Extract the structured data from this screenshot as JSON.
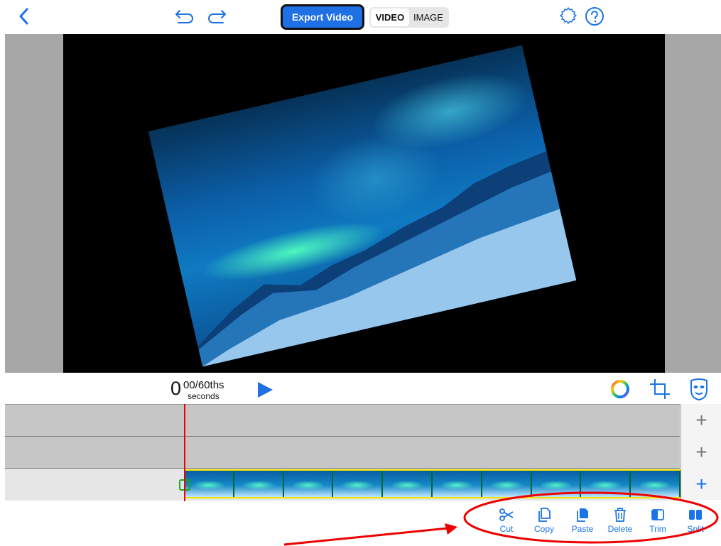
{
  "header": {
    "export_label": "Export Video",
    "mode_video": "VIDEO",
    "mode_image": "IMAGE"
  },
  "timecode": {
    "value": "0",
    "fraction": "00/60ths",
    "unit": "seconds"
  },
  "tracks": [
    {
      "add": "+"
    },
    {
      "add": "+"
    },
    {
      "add": "+"
    }
  ],
  "toolbar": {
    "cut": "Cut",
    "copy": "Copy",
    "paste": "Paste",
    "delete": "Delete",
    "trim": "Trim",
    "split": "Split"
  },
  "colors": {
    "accent": "#1a73e8",
    "export_bg": "#1f6fe5",
    "playhead": "#e00000",
    "clip_border": "#f0e200",
    "annotation": "#e00000"
  },
  "icons": [
    "back-chevron-icon",
    "undo-icon",
    "redo-icon",
    "settings-gear-icon",
    "help-icon",
    "play-icon",
    "color-wheel-icon",
    "crop-icon",
    "mask-icon",
    "scissors-icon",
    "copy-icon",
    "paste-icon",
    "trash-icon",
    "trim-icon",
    "split-icon"
  ]
}
